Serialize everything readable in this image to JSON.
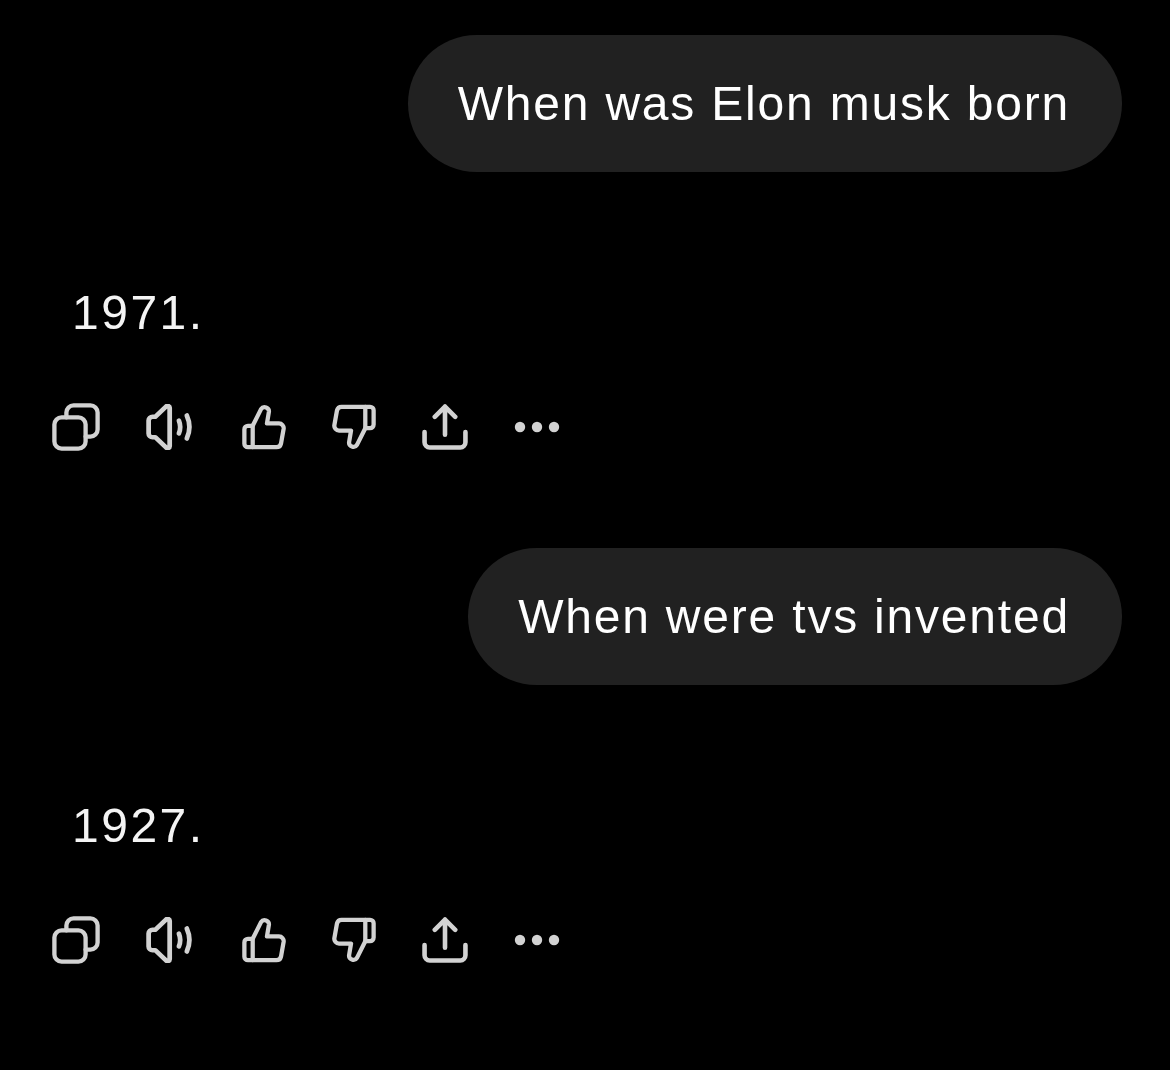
{
  "conversation": [
    {
      "kind": "user",
      "text": "When was Elon musk born"
    },
    {
      "kind": "assistant",
      "text": "1971."
    },
    {
      "kind": "user",
      "text": "When were tvs invented"
    },
    {
      "kind": "assistant",
      "text": "1927."
    }
  ]
}
